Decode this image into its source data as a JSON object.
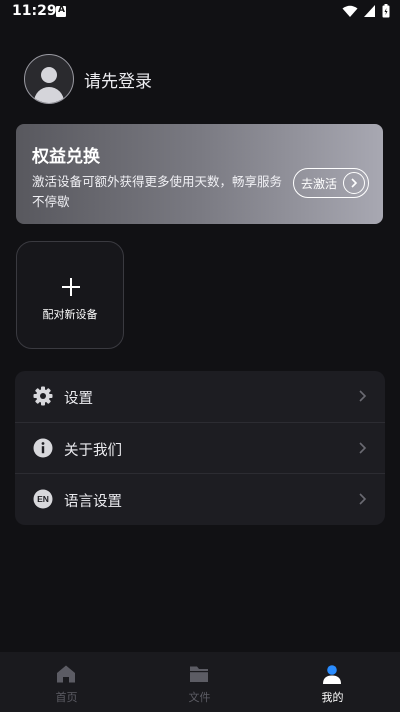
{
  "status_bar": {
    "time": "11:29"
  },
  "profile": {
    "login_prompt": "请先登录"
  },
  "benefit_card": {
    "title": "权益兑换",
    "description": "激活设备可额外获得更多使用天数，畅享服务不停歇",
    "activate_label": "去激活"
  },
  "pair_device": {
    "label": "配对新设备"
  },
  "menu": {
    "items": [
      {
        "label": "设置",
        "icon": "gear-icon"
      },
      {
        "label": "关于我们",
        "icon": "info-icon"
      },
      {
        "label": "语言设置",
        "icon": "language-en-icon"
      }
    ]
  },
  "bottom_nav": {
    "items": [
      {
        "label": "首页",
        "icon": "home-icon"
      },
      {
        "label": "文件",
        "icon": "folder-icon"
      },
      {
        "label": "我的",
        "icon": "person-icon"
      }
    ],
    "active_index": 2,
    "active_color": "#2a8cff"
  }
}
